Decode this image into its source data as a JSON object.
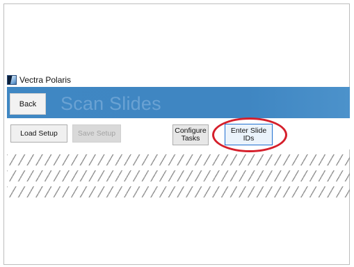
{
  "app": {
    "title": "Vectra Polaris"
  },
  "header": {
    "back_label": "Back",
    "page_title": "Scan Slides"
  },
  "toolbar": {
    "load_setup": "Load Setup",
    "save_setup": "Save Setup",
    "configure_tasks": "Configure\nTasks",
    "enter_slide_ids": "Enter Slide\nIDs"
  },
  "colors": {
    "header_blue": "#3f87c3",
    "title_text": "#6aa2d3",
    "focus_blue": "#1f6fd1",
    "highlight_red": "#d51f2b"
  },
  "icons": [
    "vectra-polaris-app-icon"
  ]
}
